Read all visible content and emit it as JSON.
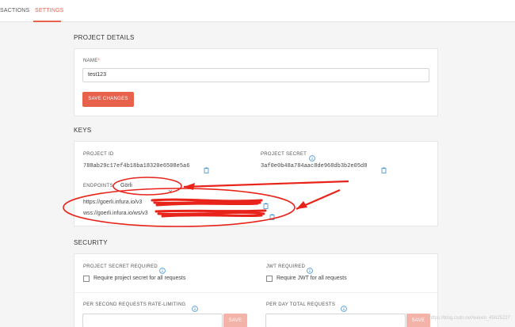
{
  "tabs": {
    "transactions": "SACTIONS",
    "settings": "SETTINGS"
  },
  "project_details": {
    "title": "PROJECT DETAILS",
    "name_label": "NAME",
    "name_required_mark": "*",
    "name_value": "test123",
    "save_button": "SAVE CHANGES"
  },
  "keys": {
    "title": "KEYS",
    "project_id_label": "PROJECT ID",
    "project_id_value": "788ab29c17ef4b18ba18320e6508e5a6",
    "project_secret_label": "PROJECT SECRET",
    "project_secret_value": "3af0e0b48a784aac8de968db3b2e05d8",
    "endpoints_label": "ENDPOINTS",
    "network_select": "Görli",
    "https_endpoint": "https://goerli.infura.io/v3",
    "wss_endpoint": "wss://goerli.infura.io/ws/v3"
  },
  "security": {
    "title": "SECURITY",
    "secret_required_label": "PROJECT SECRET REQUIRED",
    "secret_required_checkbox": "Require project secret for all requests",
    "jwt_required_label": "JWT REQUIRED",
    "jwt_required_checkbox": "Require JWT for all requests",
    "per_second_label": "PER SECOND REQUESTS RATE-LIMITING",
    "per_day_label": "PER DAY TOTAL REQUESTS",
    "save_button_small": "SAVE",
    "save_button_small_2": "SAVE"
  },
  "watermark": "https://blog.csdn.net/weixin_45625227",
  "colors": {
    "accent": "#e8614b",
    "annotation_red": "#e8231a"
  },
  "icons": {
    "copy": "copy-icon",
    "info": "info-icon",
    "chevron": "chevron-down-icon"
  }
}
